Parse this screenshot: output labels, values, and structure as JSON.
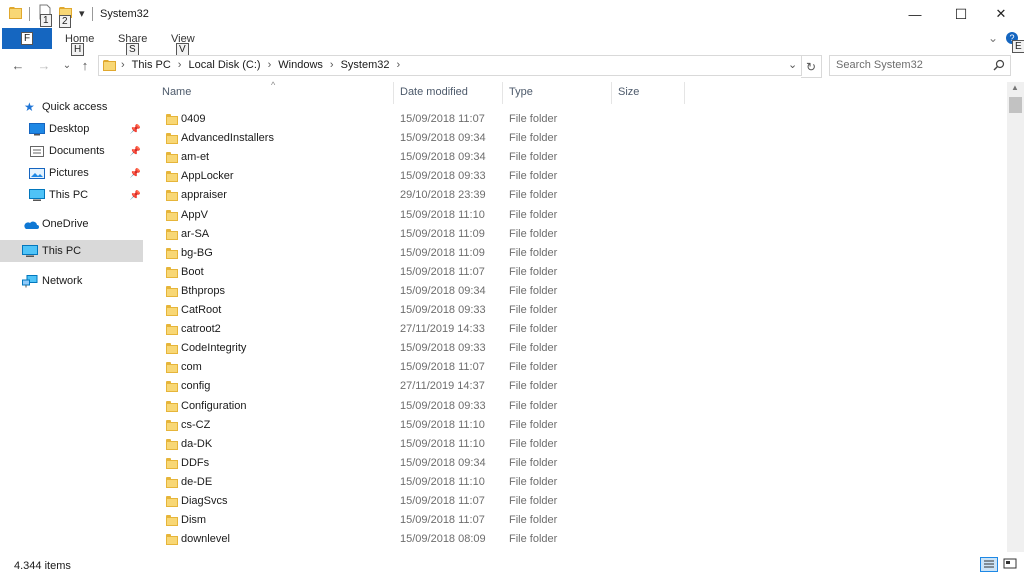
{
  "window": {
    "title": "System32",
    "minimize": "—",
    "maximize": "☐",
    "close": "✕",
    "collapse_ribbon": "⌄",
    "help": "?",
    "help_key_tip": "E"
  },
  "qat": {
    "properties_key_tip": "1",
    "new_folder_key_tip": "2",
    "dropdown": "▾"
  },
  "ribbon": {
    "file_label": "F",
    "tabs": [
      {
        "label": "Home",
        "key_tip": "H"
      },
      {
        "label": "Share",
        "key_tip": "S"
      },
      {
        "label": "View",
        "key_tip": "V"
      }
    ]
  },
  "nav": {
    "back": "←",
    "forward": "→",
    "recent": "⌄",
    "up": "↑",
    "address_dropdown": "⌄",
    "refresh": "↻"
  },
  "address": {
    "crumbs": [
      "This PC",
      "Local Disk (C:)",
      "Windows",
      "System32"
    ],
    "separator": "›"
  },
  "search": {
    "placeholder": "Search System32",
    "icon": "search-icon"
  },
  "navpane": {
    "quick_access": "Quick access",
    "pinned": [
      {
        "label": "Desktop",
        "icon": "desktop-icon"
      },
      {
        "label": "Documents",
        "icon": "documents-icon"
      },
      {
        "label": "Pictures",
        "icon": "pictures-icon"
      },
      {
        "label": "This PC",
        "icon": "computer-icon"
      }
    ],
    "onedrive": "OneDrive",
    "this_pc": "This PC",
    "network": "Network"
  },
  "columns": {
    "name": "Name",
    "date": "Date modified",
    "type": "Type",
    "size": "Size",
    "sort_indicator": "^"
  },
  "files": [
    {
      "name": "0409",
      "date": "15/09/2018 11:07",
      "type": "File folder"
    },
    {
      "name": "AdvancedInstallers",
      "date": "15/09/2018 09:34",
      "type": "File folder"
    },
    {
      "name": "am-et",
      "date": "15/09/2018 09:34",
      "type": "File folder"
    },
    {
      "name": "AppLocker",
      "date": "15/09/2018 09:33",
      "type": "File folder"
    },
    {
      "name": "appraiser",
      "date": "29/10/2018 23:39",
      "type": "File folder"
    },
    {
      "name": "AppV",
      "date": "15/09/2018 11:10",
      "type": "File folder"
    },
    {
      "name": "ar-SA",
      "date": "15/09/2018 11:09",
      "type": "File folder"
    },
    {
      "name": "bg-BG",
      "date": "15/09/2018 11:09",
      "type": "File folder"
    },
    {
      "name": "Boot",
      "date": "15/09/2018 11:07",
      "type": "File folder"
    },
    {
      "name": "Bthprops",
      "date": "15/09/2018 09:34",
      "type": "File folder"
    },
    {
      "name": "CatRoot",
      "date": "15/09/2018 09:33",
      "type": "File folder"
    },
    {
      "name": "catroot2",
      "date": "27/11/2019 14:33",
      "type": "File folder"
    },
    {
      "name": "CodeIntegrity",
      "date": "15/09/2018 09:33",
      "type": "File folder"
    },
    {
      "name": "com",
      "date": "15/09/2018 11:07",
      "type": "File folder"
    },
    {
      "name": "config",
      "date": "27/11/2019 14:37",
      "type": "File folder"
    },
    {
      "name": "Configuration",
      "date": "15/09/2018 09:33",
      "type": "File folder"
    },
    {
      "name": "cs-CZ",
      "date": "15/09/2018 11:10",
      "type": "File folder"
    },
    {
      "name": "da-DK",
      "date": "15/09/2018 11:10",
      "type": "File folder"
    },
    {
      "name": "DDFs",
      "date": "15/09/2018 09:34",
      "type": "File folder"
    },
    {
      "name": "de-DE",
      "date": "15/09/2018 11:10",
      "type": "File folder"
    },
    {
      "name": "DiagSvcs",
      "date": "15/09/2018 11:07",
      "type": "File folder"
    },
    {
      "name": "Dism",
      "date": "15/09/2018 11:07",
      "type": "File folder"
    },
    {
      "name": "downlevel",
      "date": "15/09/2018 08:09",
      "type": "File folder"
    }
  ],
  "status": {
    "item_count": "4.344 items"
  },
  "colors": {
    "file_tab": "#1566c0",
    "selection": "#d9d9d9",
    "folder": "#f8d775"
  }
}
